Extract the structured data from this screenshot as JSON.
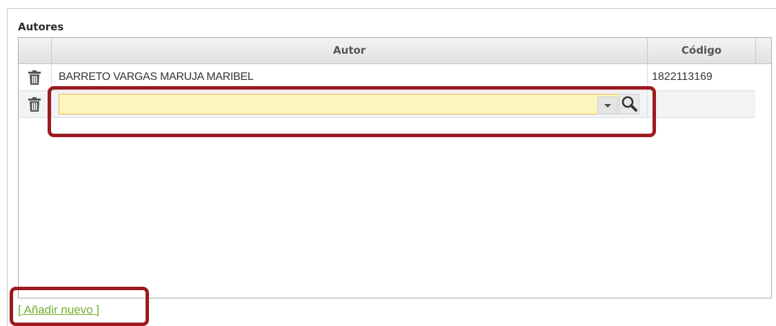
{
  "section": {
    "title": "Autores"
  },
  "grid": {
    "columns": [
      "Autor",
      "Código"
    ],
    "rows": [
      {
        "autor": "BARRETO VARGAS MARUJA MARIBEL",
        "codigo": "1822113169"
      },
      {
        "autor": "",
        "codigo": ""
      }
    ],
    "new_row_input": {
      "value": "",
      "placeholder": ""
    }
  },
  "actions": {
    "add_new_label": "[ Añadir nuevo ]"
  },
  "icons": {
    "delete": "trash-icon",
    "dropdown": "chevron-down-icon",
    "search": "search-icon"
  },
  "colors": {
    "highlight": "#9c1a1f",
    "link": "#6fae2c",
    "input_bg": "#fff6bf",
    "input_border": "#e4b65a"
  }
}
